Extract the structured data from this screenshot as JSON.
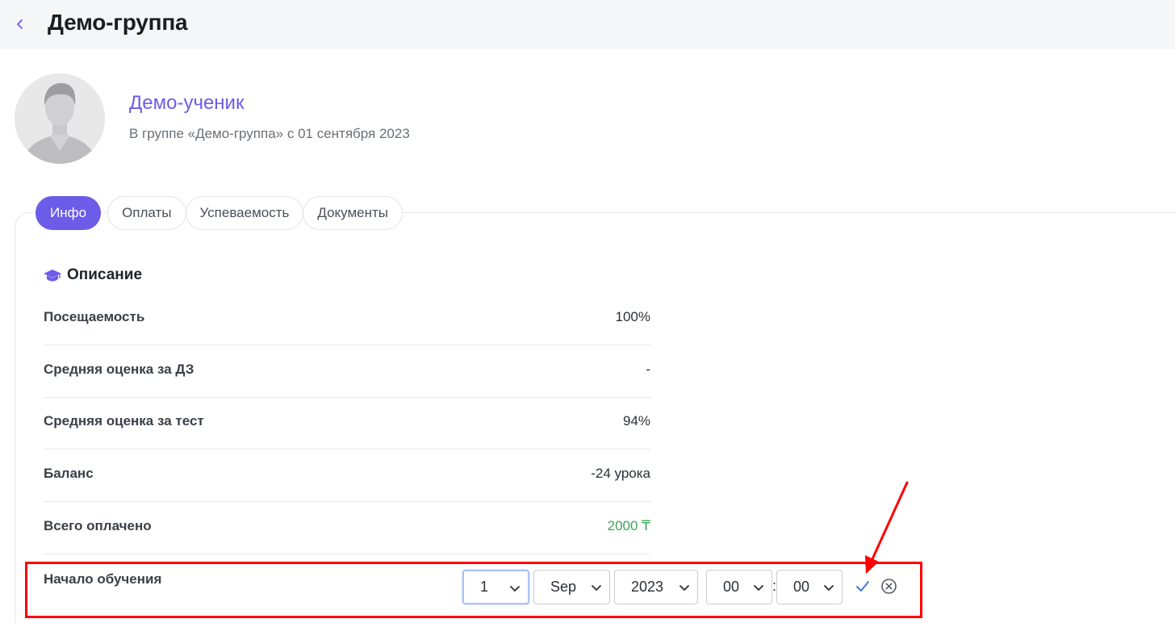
{
  "header": {
    "title": "Демо-группа",
    "back_icon": "chevron-left-icon",
    "accent_color": "#6c5ce7"
  },
  "student": {
    "name": "Демо-ученик",
    "subtitle": "В группе «Демо-группа» с 01 сентября 2023"
  },
  "tabs": [
    {
      "label": "Инфо",
      "active": true
    },
    {
      "label": "Оплаты",
      "active": false
    },
    {
      "label": "Успеваемость",
      "active": false
    },
    {
      "label": "Документы",
      "active": false
    }
  ],
  "section": {
    "title": "Описание",
    "icon": "graduation-cap-icon"
  },
  "rows": [
    {
      "label": "Посещаемость",
      "value": "100%"
    },
    {
      "label": "Средняя оценка за ДЗ",
      "value": "-"
    },
    {
      "label": "Средняя оценка за тест",
      "value": "94%"
    },
    {
      "label": "Баланс",
      "value": "-24 урока"
    },
    {
      "label": "Всего оплачено",
      "value": "2000 ₸"
    }
  ],
  "start_date": {
    "label": "Начало обучения",
    "day": "1",
    "month": "Sep",
    "year": "2023",
    "hour": "00",
    "minute": "00",
    "separator": ":",
    "confirm_icon": "checkmark-icon",
    "cancel_icon": "cancel-circle-icon"
  },
  "colors": {
    "annotation": "#ff0000",
    "paid_value": "#3aa655"
  }
}
